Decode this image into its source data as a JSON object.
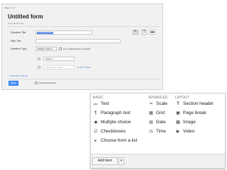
{
  "form": {
    "page_tag": "Page 1 of 1",
    "title": "Untitled form",
    "description_placeholder": "Form Description",
    "drag_handle": "::::",
    "toolbar": {
      "edit_icon": "pencil-icon",
      "duplicate_icon": "copy-icon",
      "delete_icon": "trash-icon"
    },
    "question_title_label": "Question Title",
    "question_title_value": "Untitled Question",
    "help_text_label": "Help Text",
    "question_type_label": "Question Type",
    "question_type_value": "Multiple choice",
    "go_to_page_label": "Go to page based on answer",
    "options": [
      "Option 1"
    ],
    "add_option_placeholder": "Click to add option",
    "add_other_prefix": "or",
    "add_other_link": "Add \"Other\"",
    "advanced_settings": "+ Advanced settings",
    "done_label": "Done",
    "required_label": "Required question"
  },
  "menu": {
    "headers": {
      "basic": "BASIC",
      "advanced": "ADVANCED",
      "layout": "LAYOUT"
    },
    "basic": [
      {
        "icon": "abc-icon",
        "glyph": "abc",
        "label": "Text"
      },
      {
        "icon": "paragraph-icon",
        "glyph": "¶",
        "label": "Paragraph text"
      },
      {
        "icon": "radio-icon",
        "glyph": "◆",
        "label": "Multiple choice"
      },
      {
        "icon": "checkbox-icon",
        "glyph": "☑",
        "label": "Checkboxes"
      },
      {
        "icon": "list-icon",
        "glyph": "▸",
        "label": "Choose from a list"
      }
    ],
    "advanced": [
      {
        "icon": "scale-icon",
        "glyph": "━",
        "label": "Scale"
      },
      {
        "icon": "grid-icon",
        "glyph": "▦",
        "label": "Grid"
      },
      {
        "icon": "date-icon",
        "glyph": "▤",
        "label": "Date"
      },
      {
        "icon": "clock-icon",
        "glyph": "◷",
        "label": "Time"
      }
    ],
    "layout": [
      {
        "icon": "section-header-icon",
        "glyph": "T",
        "label": "Section header"
      },
      {
        "icon": "page-break-icon",
        "glyph": "▣",
        "label": "Page break"
      },
      {
        "icon": "image-icon",
        "glyph": "▩",
        "label": "Image"
      },
      {
        "icon": "video-icon",
        "glyph": "▶",
        "label": "Video"
      }
    ],
    "add_item_label": "Add item",
    "add_item_arrow": "▾"
  }
}
